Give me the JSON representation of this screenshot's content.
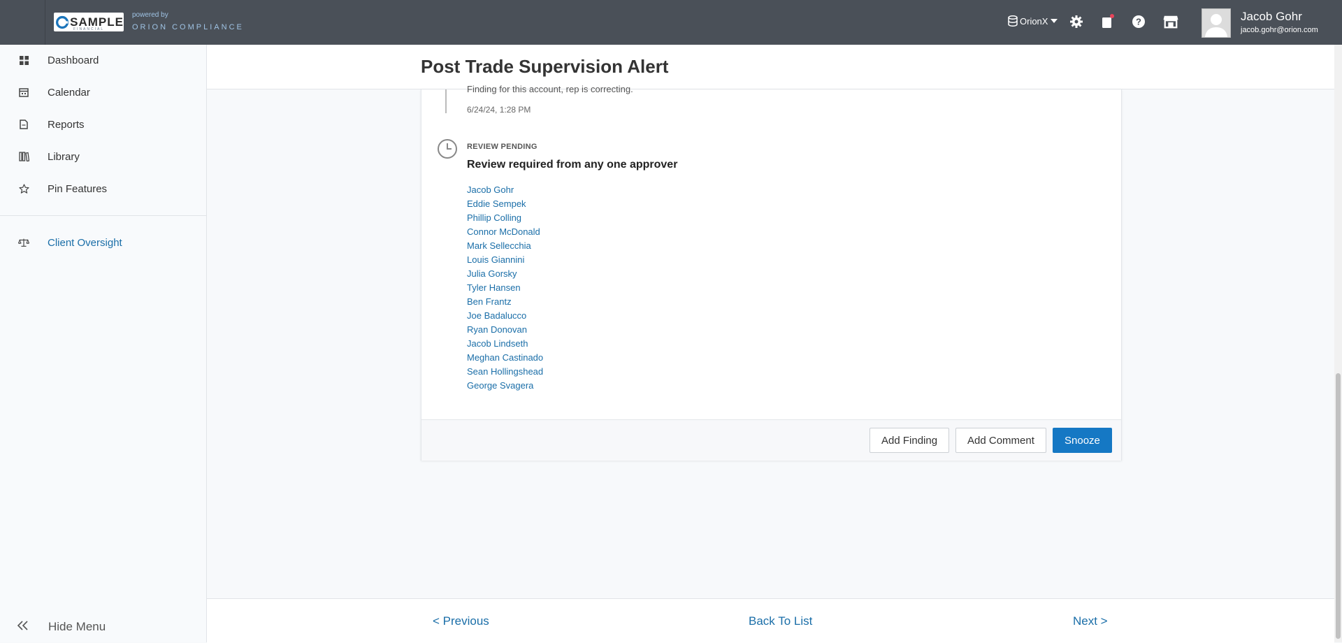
{
  "topbar": {
    "logo_text": "SAMPLE",
    "logo_sub": "FINANCIAL",
    "powered_by": "powered by",
    "brand": "ORION COMPLIANCE",
    "database": "OrionX",
    "user_name": "Jacob Gohr",
    "user_email": "jacob.gohr@orion.com",
    "notification_color": "#e8445a"
  },
  "sidebar": {
    "items": [
      {
        "label": "Dashboard",
        "icon": "dashboard-icon"
      },
      {
        "label": "Calendar",
        "icon": "calendar-icon"
      },
      {
        "label": "Reports",
        "icon": "reports-icon"
      },
      {
        "label": "Library",
        "icon": "library-icon"
      },
      {
        "label": "Pin Features",
        "icon": "star-icon"
      },
      {
        "label": "Client Oversight",
        "icon": "scale-icon"
      }
    ],
    "hide_menu": "Hide Menu"
  },
  "page": {
    "title": "Post Trade Supervision Alert"
  },
  "timeline": {
    "prev_comment": "Finding for this account, rep is correcting.",
    "prev_timestamp": "6/24/24, 1:28 PM",
    "review_status": "REVIEW PENDING",
    "review_title": "Review required from any one approver",
    "approvers": [
      "Jacob Gohr",
      "Eddie Sempek",
      "Phillip Colling",
      "Connor McDonald",
      "Mark Sellecchia",
      "Louis Giannini",
      "Julia Gorsky",
      "Tyler Hansen",
      "Ben Frantz",
      "Joe Badalucco",
      "Ryan Donovan",
      "Jacob Lindseth",
      "Meghan Castinado",
      "Sean Hollingshead",
      "George Svagera"
    ]
  },
  "actions": {
    "add_finding": "Add Finding",
    "add_comment": "Add Comment",
    "snooze": "Snooze"
  },
  "pager": {
    "previous": "< Previous",
    "back": "Back To List",
    "next": "Next >"
  }
}
